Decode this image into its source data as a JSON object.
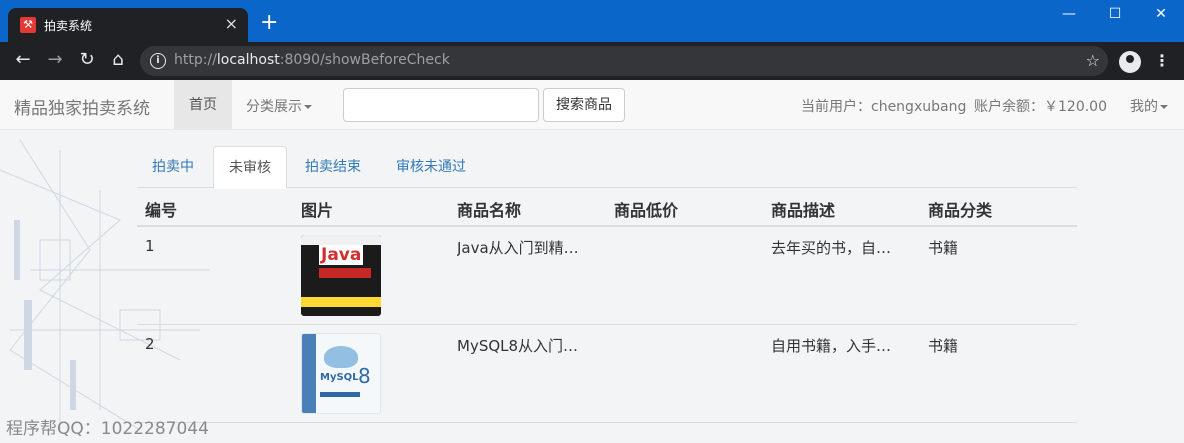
{
  "browser": {
    "tab_title": "拍卖系统",
    "tab_favicon_glyph": "⚒",
    "new_tab_label": "+",
    "window_controls": {
      "minimize": "—",
      "maximize": "☐",
      "close": "✕"
    },
    "url_prefix": "http://",
    "url_host": "localhost",
    "url_rest": ":8090/showBeforeCheck",
    "icons": [
      "back-icon",
      "forward-icon",
      "reload-icon",
      "home-icon",
      "info-icon",
      "star-icon",
      "profile-icon",
      "menu-icon"
    ]
  },
  "navbar": {
    "brand": "精品独家拍卖系统",
    "home": "首页",
    "category": "分类展示",
    "search_value": "",
    "search_button": "搜索商品",
    "current_user": "当前用户：chengxubang",
    "balance": "账户余额：￥120.00",
    "mine": "我的"
  },
  "tabs": [
    {
      "label": "拍卖中",
      "active": false
    },
    {
      "label": "未审核",
      "active": true
    },
    {
      "label": "拍卖结束",
      "active": false
    },
    {
      "label": "审核未通过",
      "active": false
    }
  ],
  "table": {
    "headers": [
      "编号",
      "图片",
      "商品名称",
      "商品低价",
      "商品描述",
      "商品分类"
    ],
    "rows": [
      {
        "id": "1",
        "image": "java-book-cover",
        "name": "Java从入门到精…",
        "low_price": "",
        "desc": "去年买的书，自…",
        "category": "书籍"
      },
      {
        "id": "2",
        "image": "mysql-book-cover",
        "name": "MySQL8从入门…",
        "low_price": "",
        "desc": "自用书籍，入手…",
        "category": "书籍"
      }
    ]
  },
  "watermark": "程序帮QQ：1022287044",
  "colors": {
    "link": "#337ab7",
    "chrome_blue": "#0a66c8",
    "chrome_dark": "#202124"
  }
}
